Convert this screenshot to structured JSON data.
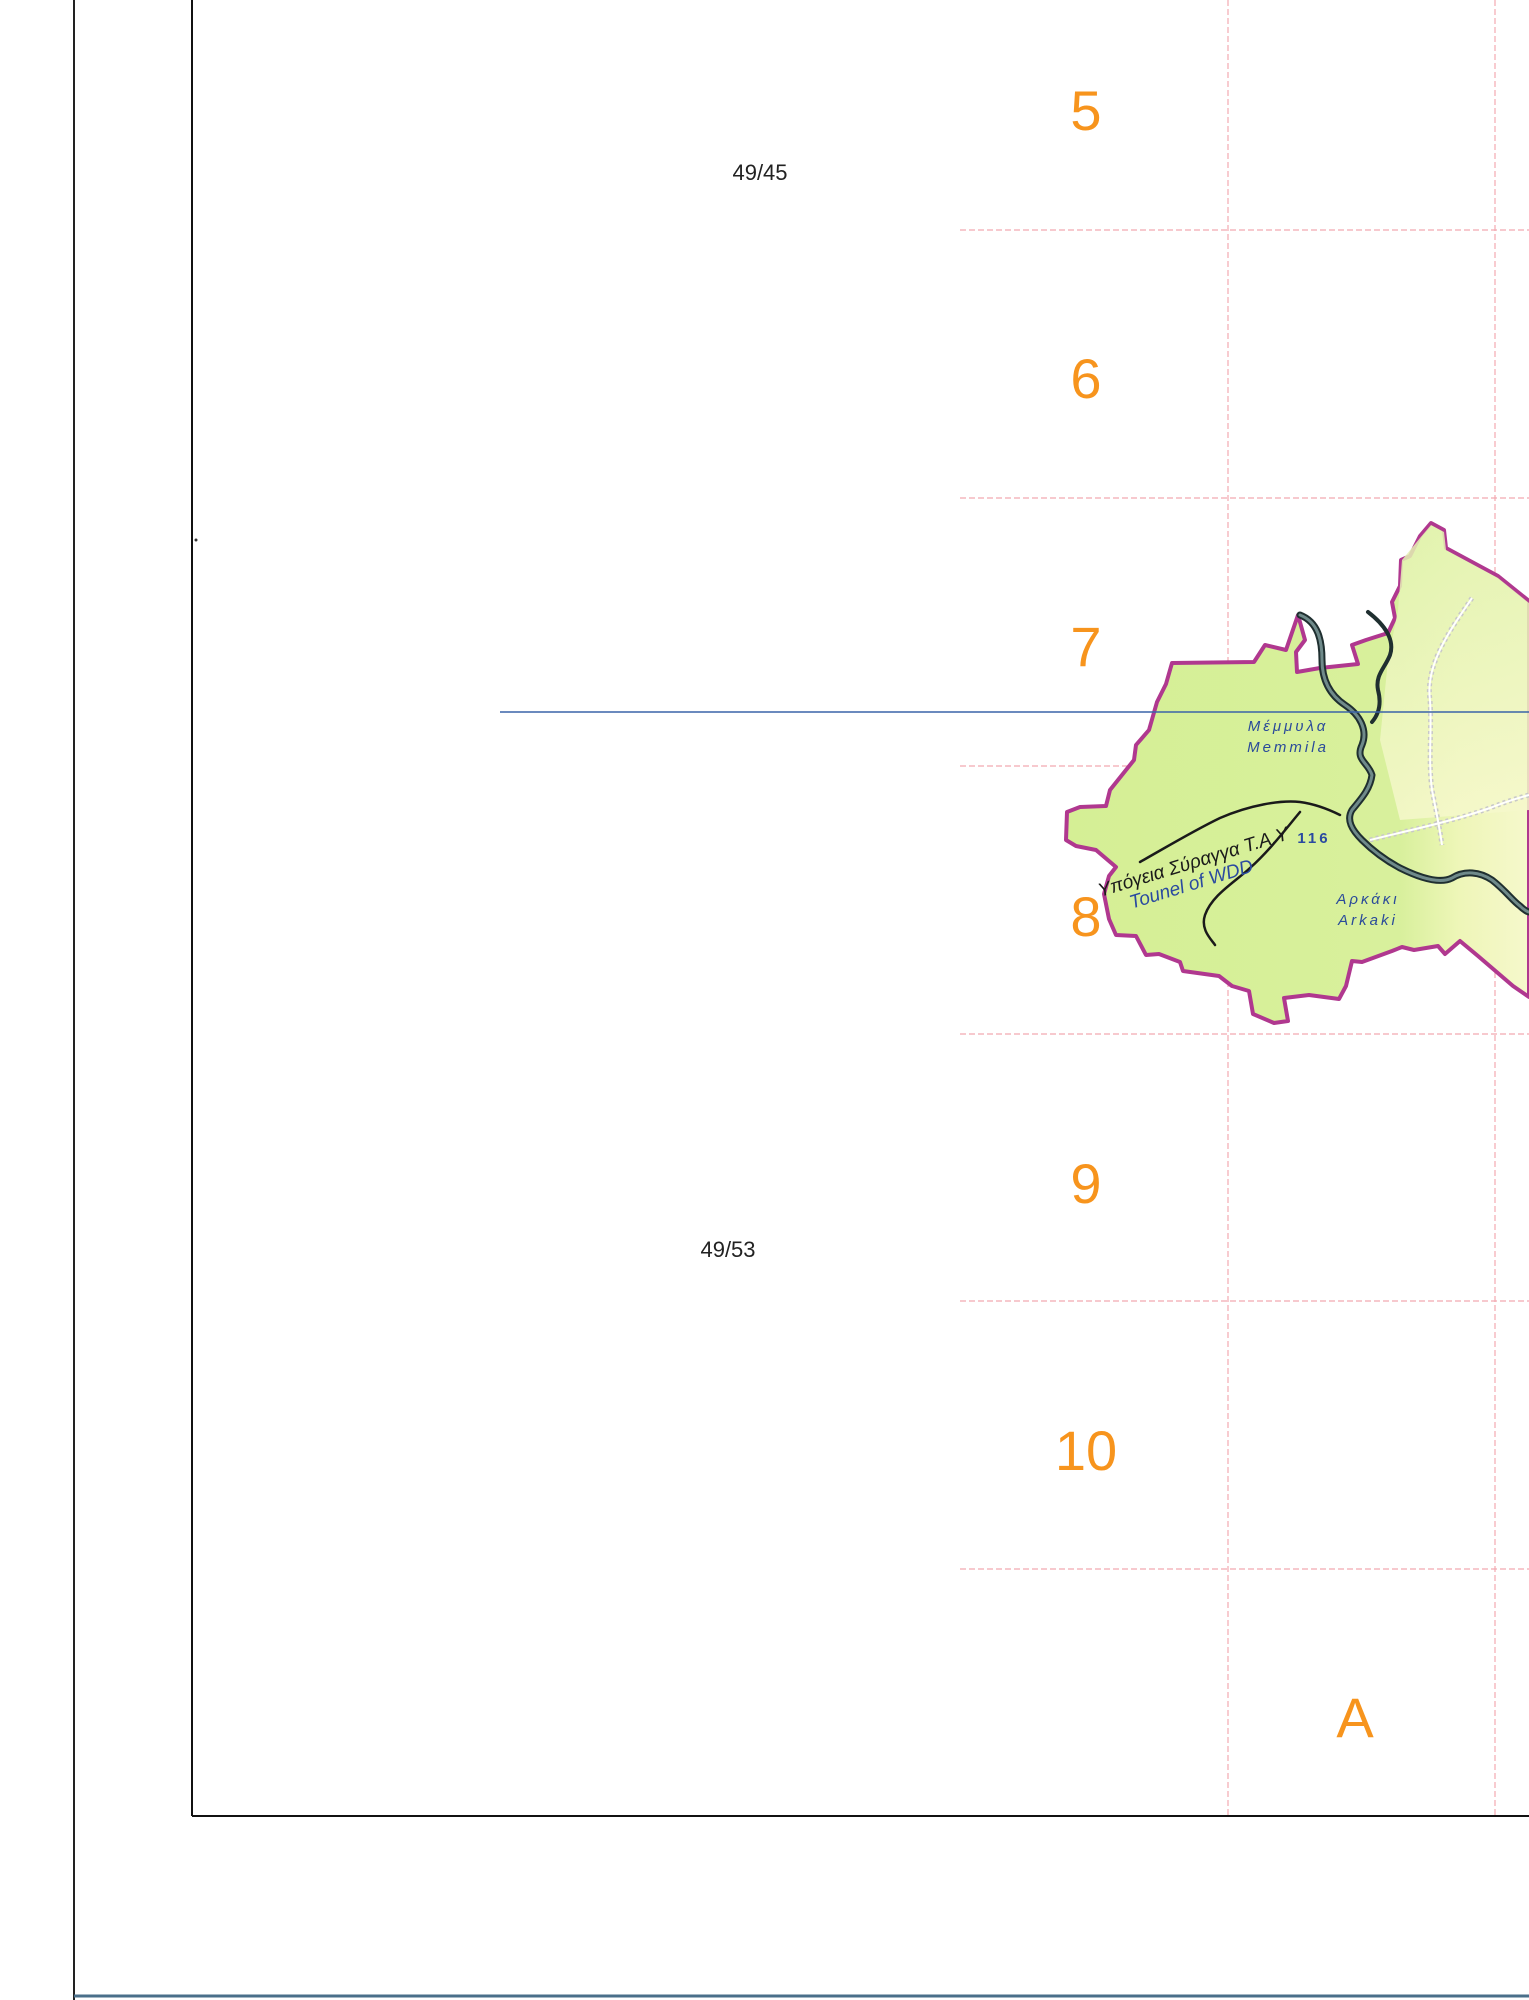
{
  "colors": {
    "grid_number": "#f7941d",
    "grid_line": "#f2a9b0",
    "frame": "#111111",
    "region_fill": "#d7f09a",
    "region_fill_light": "#f4f7c4",
    "region_border": "#b0388f",
    "river": "#3d5a5a",
    "river_edge": "#1f2f30",
    "blue_line": "#3a63a8",
    "place_text": "#2a4a9a",
    "road_text": "#2a4aa0",
    "tunnel_text": "#1a1a1a",
    "tunnel_text_en": "#2a4aa0"
  },
  "sheets": {
    "upper": "49/45",
    "lower": "49/53"
  },
  "grid": {
    "rows": [
      "5",
      "6",
      "7",
      "8",
      "9",
      "10"
    ],
    "column": "A"
  },
  "places": {
    "memmila_gr": "Μέμμυλα",
    "memmila_en": "Memmila",
    "arkaki_gr": "Αρκάκι",
    "arkaki_en": "Arkaki"
  },
  "road": {
    "number": "116"
  },
  "tunnel": {
    "label_gr": "Υπόγεια Σύραγγα Τ.Α.Υ",
    "label_en": "Tounel of WDD"
  }
}
